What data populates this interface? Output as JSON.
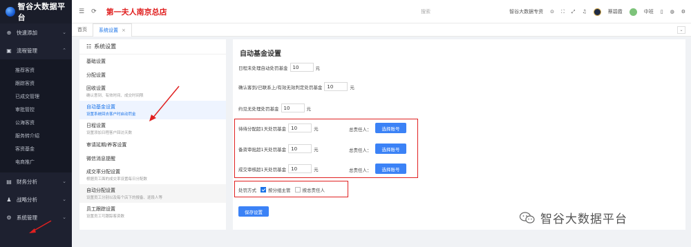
{
  "app": {
    "title": "智谷大数据平台",
    "store_name": "第一夫人南京总店"
  },
  "topbar": {
    "search_placeholder": "搜索",
    "user_center": "智谷大数据专资",
    "username": "蔡碧霞",
    "role": "中班"
  },
  "sidebar": {
    "items": [
      {
        "label": "快速添加",
        "icon": "plus-circle-icon"
      },
      {
        "label": "流程管理",
        "icon": "camera-icon"
      }
    ],
    "sub_items": [
      "推荐客资",
      "跟踪客资",
      "已成交管理",
      "审批管控",
      "公海客资",
      "服务转介绍",
      "客资基金",
      "电商推广"
    ],
    "bottom_items": [
      {
        "label": "财务分析",
        "icon": "briefcase-icon"
      },
      {
        "label": "战略分析",
        "icon": "person-icon"
      },
      {
        "label": "系统管理",
        "icon": "gear-icon"
      }
    ]
  },
  "tabs": [
    {
      "label": "首页"
    },
    {
      "label": "系统设置"
    }
  ],
  "left_panel": {
    "title": "系统设置",
    "items": [
      {
        "title": "基础设置",
        "desc": ""
      },
      {
        "title": "分配设置",
        "desc": ""
      },
      {
        "title": "回收设置",
        "desc": "确认意到、有效时间、成交时间限"
      },
      {
        "title": "自动基金设置",
        "desc": "设置系统回去客户时启动罚金"
      },
      {
        "title": "日程设置",
        "desc": "设置添加日程客户回访天数"
      },
      {
        "title": "审请延期/养客设置",
        "desc": ""
      },
      {
        "title": "微信消息提醒",
        "desc": ""
      },
      {
        "title": "成交率分配设置",
        "desc": "根据员工面的成交率设置每日分配数"
      },
      {
        "title": "自动分配设置",
        "desc": "设置员工分别以及每个店下的报备、逐段人等"
      },
      {
        "title": "员工跟踪设置",
        "desc": "设置员工可跟踪客资数"
      }
    ]
  },
  "main": {
    "title": "自动基金设置",
    "unit": "元",
    "rows": [
      {
        "label": "日程未处理自动处罚基金",
        "value": "10"
      },
      {
        "label": "确认客到/已联系上/有效无效判定处罚基金",
        "value": "10"
      },
      {
        "label": "约见无处理处罚基金",
        "value": "10"
      }
    ],
    "boxed_rows": [
      {
        "label": "待待分配超1天处罚基金",
        "value": "10",
        "resp_label": "总责任人：",
        "button": "选择账号"
      },
      {
        "label": "备资审批超1天处罚基金",
        "value": "10",
        "resp_label": "总责任人：",
        "button": "选择账号"
      },
      {
        "label": "成交审核超1天处罚基金",
        "value": "10",
        "resp_label": "总责任人：",
        "button": "选择账号"
      }
    ],
    "penalty_method_label": "处罚方式",
    "option1": "按分组主管",
    "option2": "按总责任人",
    "save_label": "保存设置"
  },
  "watermark": "智谷大数据平台"
}
